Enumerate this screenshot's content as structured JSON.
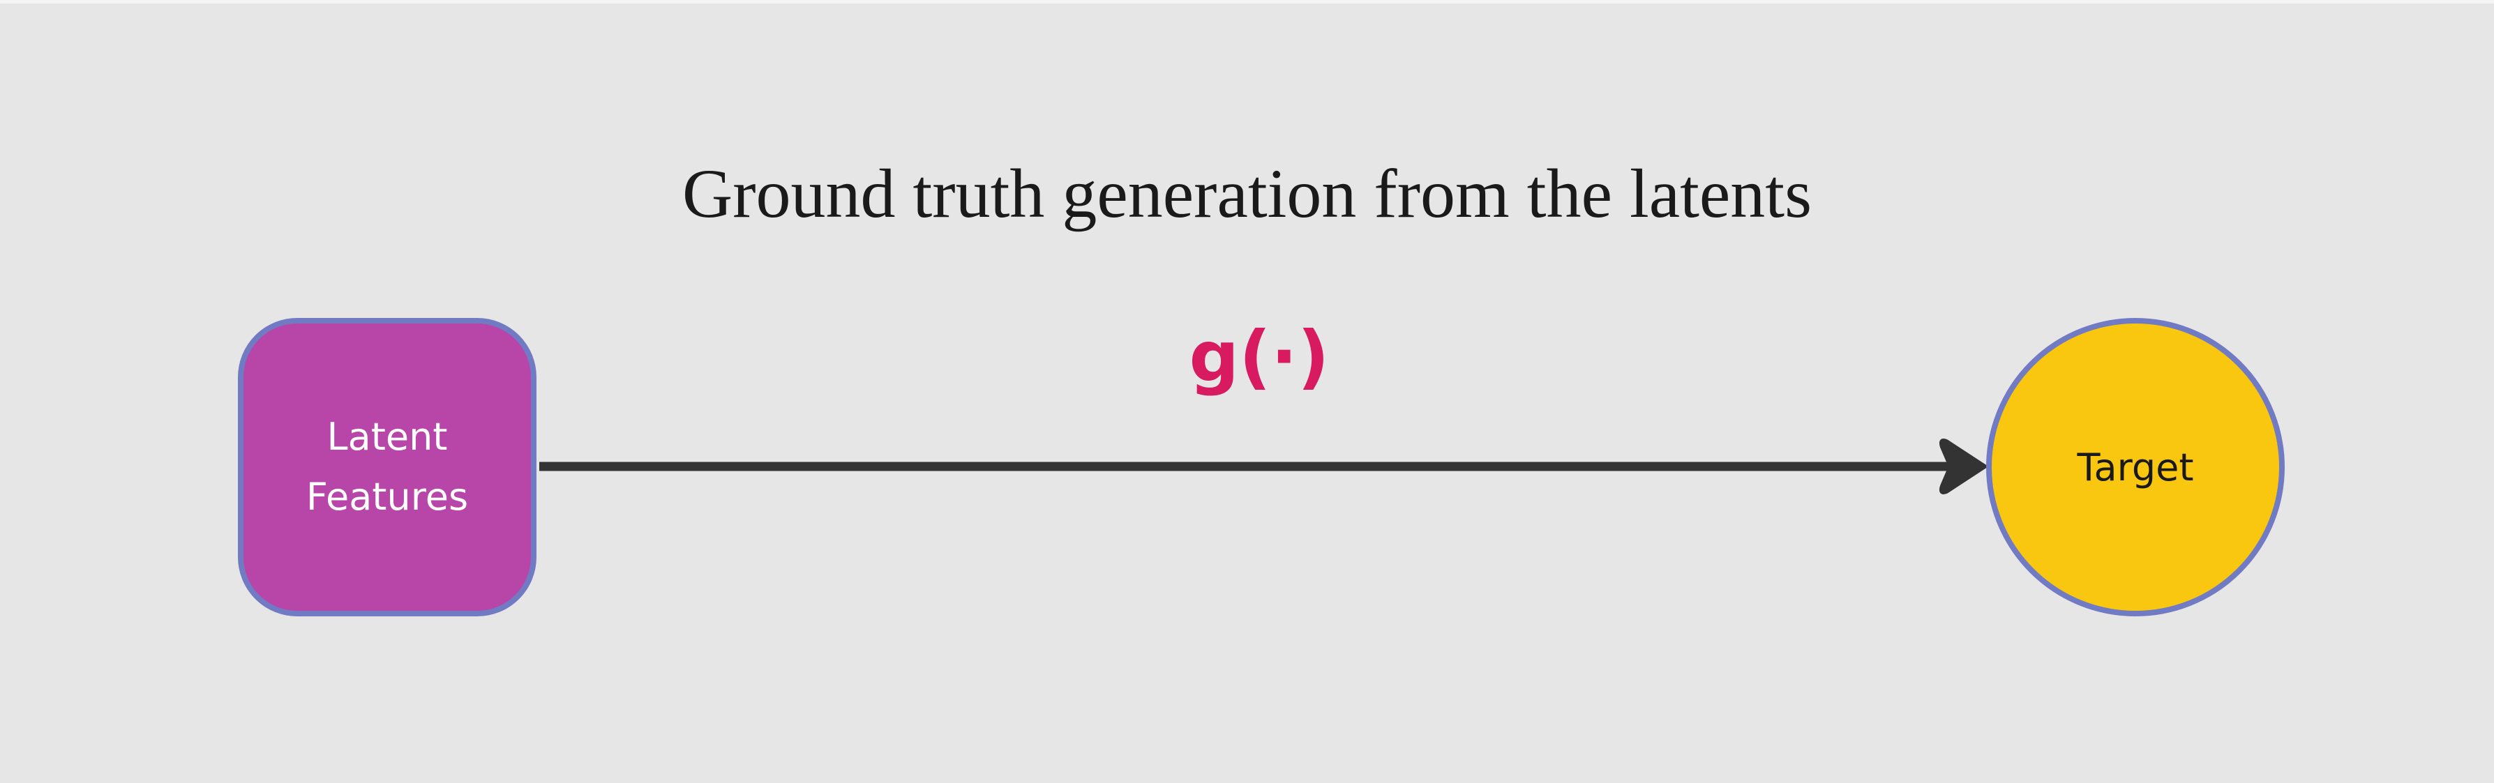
{
  "title": "Ground truth generation from the latents",
  "edge": {
    "label": "g(·)",
    "from": "Latent Features",
    "to": "Target"
  },
  "nodes": {
    "latent": {
      "label": "Latent Features",
      "shape": "rounded-square"
    },
    "target": {
      "label": "Target",
      "shape": "circle"
    }
  },
  "colors": {
    "background": "#e6e6e6",
    "latent_fill": "#b845a8",
    "target_fill": "#f9c710",
    "node_border": "#717bc3",
    "function_label": "#d81b60",
    "arrow": "#333333"
  }
}
